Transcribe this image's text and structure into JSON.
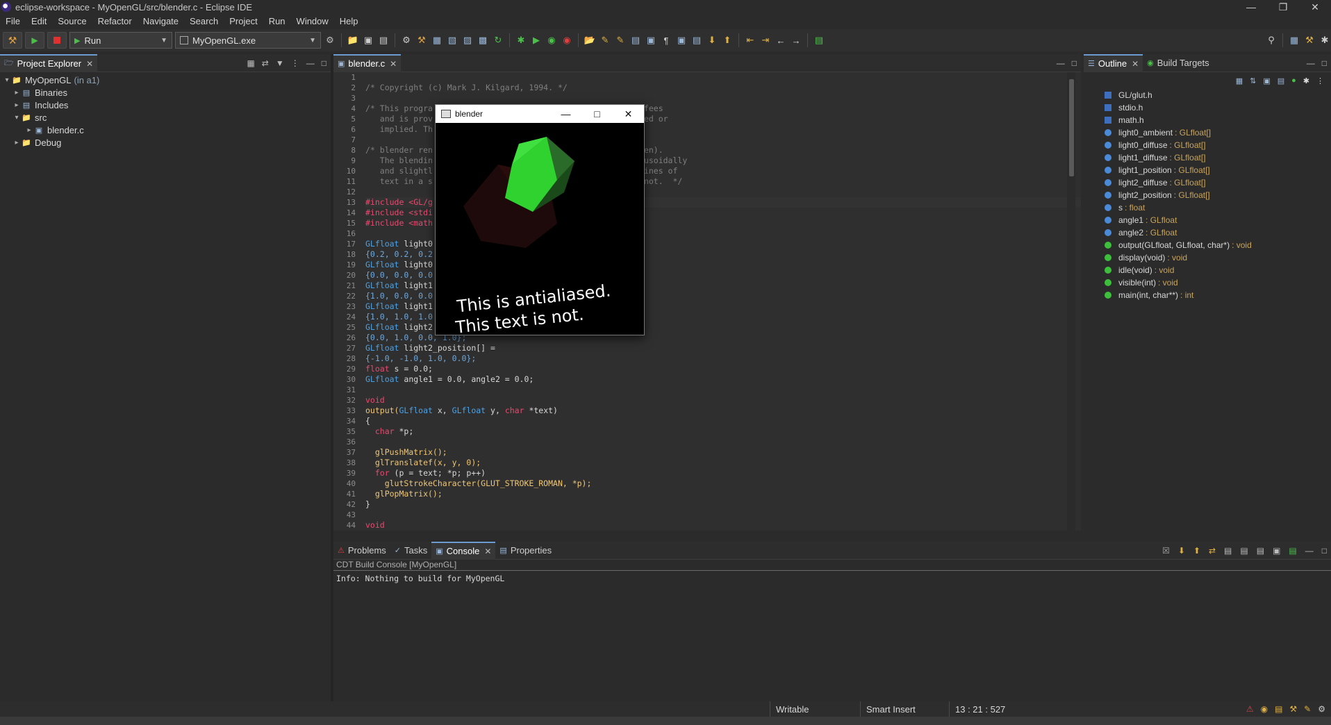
{
  "window": {
    "title": "eclipse-workspace - MyOpenGL/src/blender.c - Eclipse IDE"
  },
  "menu": [
    "File",
    "Edit",
    "Source",
    "Refactor",
    "Navigate",
    "Search",
    "Project",
    "Run",
    "Window",
    "Help"
  ],
  "toolbar": {
    "run_mode": "Run",
    "launch_target": "MyOpenGL.exe"
  },
  "project_explorer": {
    "tab_label": "Project Explorer",
    "project": "MyOpenGL",
    "project_suffix": "(in a1)",
    "items": {
      "binaries": "Binaries",
      "includes": "Includes",
      "src": "src",
      "blender_c": "blender.c",
      "debug": "Debug"
    }
  },
  "editor": {
    "tab_label": "blender.c",
    "line_numbers": [
      "1",
      "2",
      "3",
      "4",
      "5",
      "6",
      "7",
      "8",
      "9",
      "10",
      "11",
      "12",
      "13",
      "14",
      "15",
      "16",
      "17",
      "18",
      "19",
      "20",
      "21",
      "22",
      "23",
      "24",
      "25",
      "26",
      "27",
      "28",
      "29",
      "30",
      "31",
      "32",
      "33",
      "34",
      "35",
      "36",
      "37",
      "38",
      "39",
      "40",
      "41",
      "42",
      "43",
      "44"
    ],
    "code": {
      "l2": "/* Copyright (c) Mark J. Kilgard, 1994. */",
      "l4a": "/* This progra",
      "l4b": "fees",
      "l5a": "   and is prov",
      "l5b": "ed or",
      "l6": "   implied. Th",
      "l8a": "/* blender ren",
      "l8b": "en).",
      "l9a": "   The blendin",
      "l9b": "usoidally",
      "l10a": "   and slightl",
      "l10b": "ines of",
      "l11a": "   text in a s",
      "l11b": "not.  */",
      "l13": "#include <GL/g",
      "l14": "#include <stdi",
      "l15": "#include <math",
      "l17": "light0",
      "l18": "{0.2, 0.2, 0.2",
      "l19": "light0",
      "l20": "{0.0, 0.0, 0.0",
      "l21": "light1",
      "l22": "{1.0, 0.0, 0.0",
      "l23": "light1",
      "l24": "{1.0, 1.0, 1.0",
      "l25": "light2",
      "l26": "{0.0, 1.0, 0.0, 1.0};",
      "l27": " light2_position[] =",
      "l28": "{-1.0, -1.0, 1.0, 0.0};",
      "l29a": "float",
      "l29b": " s = 0.0;",
      "l30": " angle1 = 0.0, angle2 = 0.0;",
      "l32": "void",
      "l33a": "output(",
      "l33b": " x, ",
      "l33c": " y, ",
      "l33d": "char",
      "l33e": " *text)",
      "l34": "{",
      "l35a": "  char",
      "l35b": " *p;",
      "l37": "  glPushMatrix();",
      "l38": "  glTranslatef(x, y, 0);",
      "l39a": "  for",
      "l39b": " (p = text; *p; p++)",
      "l40": "    glutStrokeCharacter(GLUT_STROKE_ROMAN, *p);",
      "l41": "  glPopMatrix();",
      "l42": "}",
      "l44": "void",
      "type_glfloat": "GLfloat"
    }
  },
  "outline": {
    "tab_label": "Outline",
    "tab2_label": "Build Targets",
    "items": [
      {
        "name": "GL/glut.h",
        "type": "",
        "kind": "include"
      },
      {
        "name": "stdio.h",
        "type": "",
        "kind": "include"
      },
      {
        "name": "math.h",
        "type": "",
        "kind": "include"
      },
      {
        "name": "light0_ambient",
        "type": ": GLfloat[]",
        "kind": "var"
      },
      {
        "name": "light0_diffuse",
        "type": ": GLfloat[]",
        "kind": "var"
      },
      {
        "name": "light1_diffuse",
        "type": ": GLfloat[]",
        "kind": "var"
      },
      {
        "name": "light1_position",
        "type": ": GLfloat[]",
        "kind": "var"
      },
      {
        "name": "light2_diffuse",
        "type": ": GLfloat[]",
        "kind": "var"
      },
      {
        "name": "light2_position",
        "type": ": GLfloat[]",
        "kind": "var"
      },
      {
        "name": "s",
        "type": ": float",
        "kind": "var"
      },
      {
        "name": "angle1",
        "type": ": GLfloat",
        "kind": "var"
      },
      {
        "name": "angle2",
        "type": ": GLfloat",
        "kind": "var"
      },
      {
        "name": "output(GLfloat, GLfloat, char*)",
        "type": ": void",
        "kind": "func"
      },
      {
        "name": "display(void)",
        "type": ": void",
        "kind": "func"
      },
      {
        "name": "idle(void)",
        "type": ": void",
        "kind": "func"
      },
      {
        "name": "visible(int)",
        "type": ": void",
        "kind": "func"
      },
      {
        "name": "main(int, char**)",
        "type": ": int",
        "kind": "func"
      }
    ]
  },
  "bottom_panel": {
    "tabs": [
      "Problems",
      "Tasks",
      "Console",
      "Properties"
    ],
    "console_title": "CDT Build Console [MyOpenGL]",
    "console_output": "Info: Nothing to build for MyOpenGL"
  },
  "status": {
    "writable": "Writable",
    "insert_mode": "Smart Insert",
    "position": "13 : 21 : 527"
  },
  "blender_window": {
    "title": "blender",
    "text_line1": "This  is  antialiased.",
    "text_line2": "This  text  is  not."
  },
  "colors": {
    "accent": "#6b9bd1",
    "keyword": "#e84a6f",
    "type": "#4aa3e8",
    "outline_type": "#c9a45a",
    "green_face": "#2ecc40"
  }
}
